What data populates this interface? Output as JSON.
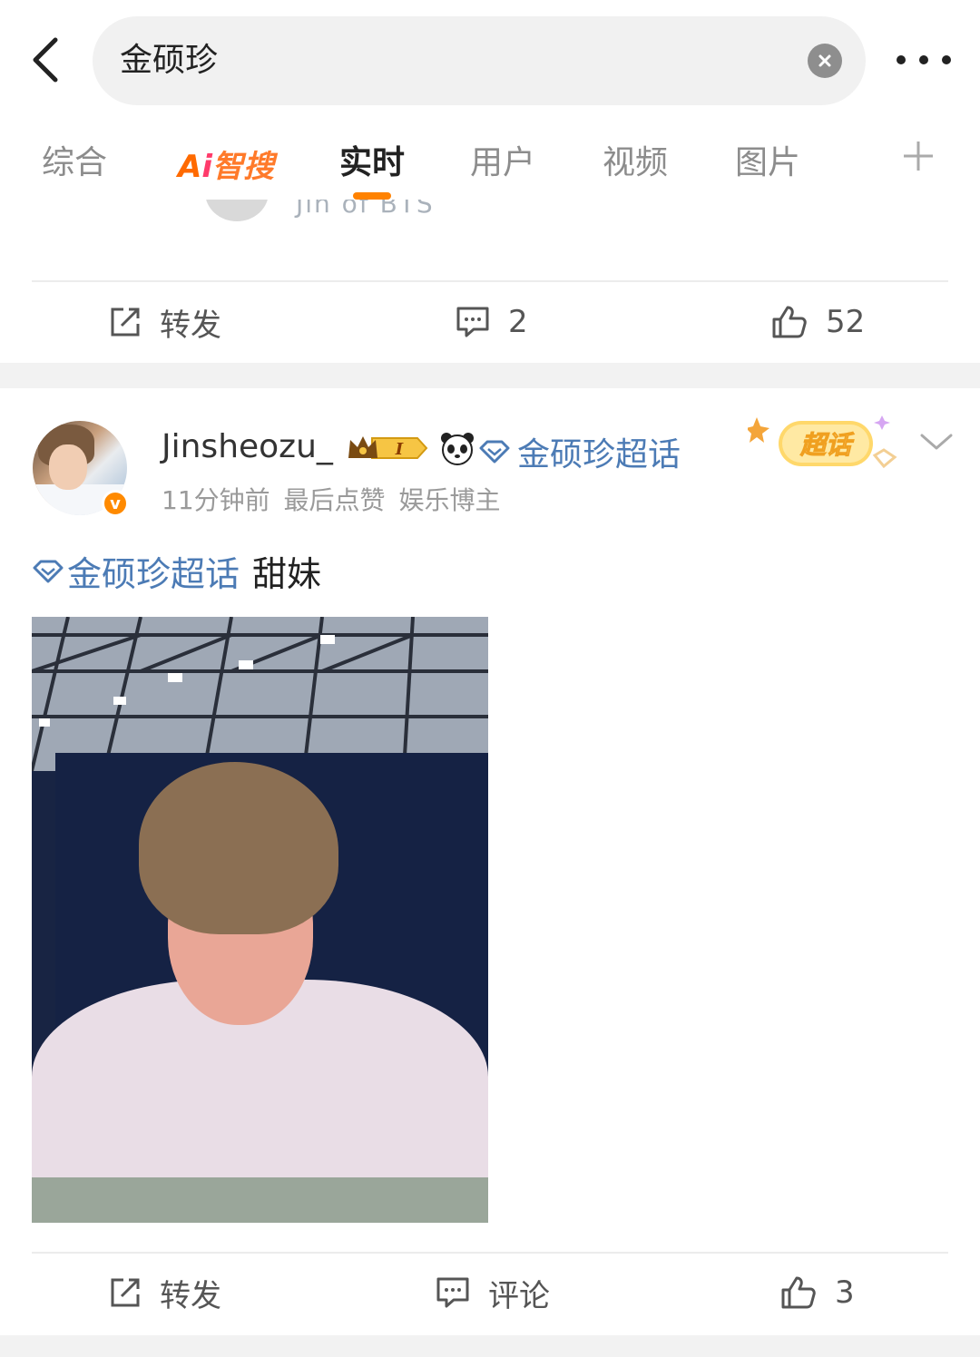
{
  "search": {
    "query": "金硕珍"
  },
  "tabs": [
    {
      "label": "综合"
    },
    {
      "label": "Ai智搜"
    },
    {
      "label": "实时"
    },
    {
      "label": "用户"
    },
    {
      "label": "视频"
    },
    {
      "label": "图片"
    }
  ],
  "active_tab": "实时",
  "prev_post": {
    "partial_text": "Jin of BTS",
    "repost_label": "转发",
    "comment_count": "2",
    "like_count": "52"
  },
  "post": {
    "username": "Jinsheozu_",
    "rank_badge": "I",
    "topic_header": "金硕珍超话",
    "meta": {
      "time": "11分钟前",
      "last_like": "最后点赞",
      "role": "娱乐博主"
    },
    "chaohua_badge": "超话",
    "content": {
      "topic": "金硕珍超话",
      "text": "甜妹"
    },
    "repost_label": "转发",
    "comment_label": "评论",
    "like_count": "3"
  },
  "colors": {
    "accent_orange": "#ff8200",
    "topic_blue": "#4c7bb5",
    "muted_gray": "#9a9a9a"
  },
  "icons": [
    "back-arrow-icon",
    "clear-icon",
    "more-icon",
    "plus-icon",
    "repost-icon",
    "comment-icon",
    "like-icon",
    "chevron-down-icon",
    "super-topic-icon"
  ]
}
